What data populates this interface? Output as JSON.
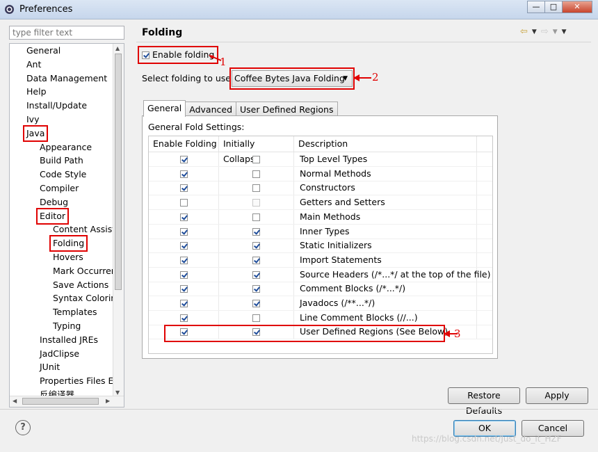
{
  "window": {
    "title": "Preferences",
    "controls": {
      "minimize": "—",
      "maximize": "□",
      "close": "✕"
    }
  },
  "filter": {
    "placeholder": "type filter text"
  },
  "tree": {
    "items": [
      {
        "label": "General",
        "level": 1
      },
      {
        "label": "Ant",
        "level": 1
      },
      {
        "label": "Data Management",
        "level": 1
      },
      {
        "label": "Help",
        "level": 1
      },
      {
        "label": "Install/Update",
        "level": 1
      },
      {
        "label": "Ivy",
        "level": 1
      },
      {
        "label": "Java",
        "level": 1
      },
      {
        "label": "Appearance",
        "level": 2
      },
      {
        "label": "Build Path",
        "level": 2
      },
      {
        "label": "Code Style",
        "level": 2
      },
      {
        "label": "Compiler",
        "level": 2
      },
      {
        "label": "Debug",
        "level": 2
      },
      {
        "label": "Editor",
        "level": 2
      },
      {
        "label": "Content Assist",
        "level": 3
      },
      {
        "label": "Folding",
        "level": 3
      },
      {
        "label": "Hovers",
        "level": 3
      },
      {
        "label": "Mark Occurren",
        "level": 3
      },
      {
        "label": "Save Actions",
        "level": 3
      },
      {
        "label": "Syntax Coloring",
        "level": 3
      },
      {
        "label": "Templates",
        "level": 3
      },
      {
        "label": "Typing",
        "level": 3
      },
      {
        "label": "Installed JREs",
        "level": 2
      },
      {
        "label": "JadClipse",
        "level": 2
      },
      {
        "label": "JUnit",
        "level": 2
      },
      {
        "label": "Properties Files Ed",
        "level": 2
      },
      {
        "label": "反编译器",
        "level": 2
      }
    ]
  },
  "page": {
    "title": "Folding",
    "enable_folding_label": "Enable folding",
    "enable_folding_checked": true,
    "select_label": "Select folding to use:",
    "select_value": "Coffee Bytes Java Folding",
    "tabs": [
      {
        "label": "General",
        "active": true
      },
      {
        "label": "Advanced",
        "active": false
      },
      {
        "label": "User Defined Regions",
        "active": false
      }
    ],
    "group_label": "General Fold Settings:",
    "columns": [
      "Enable Folding",
      "Initially Collapse",
      "Description"
    ],
    "rows": [
      {
        "enable": true,
        "collapse": false,
        "collapse_disabled": false,
        "description": "Top Level Types"
      },
      {
        "enable": true,
        "collapse": false,
        "collapse_disabled": false,
        "description": "Normal Methods"
      },
      {
        "enable": true,
        "collapse": false,
        "collapse_disabled": false,
        "description": "Constructors"
      },
      {
        "enable": false,
        "collapse": false,
        "collapse_disabled": true,
        "description": "Getters and Setters"
      },
      {
        "enable": true,
        "collapse": false,
        "collapse_disabled": false,
        "description": "Main Methods"
      },
      {
        "enable": true,
        "collapse": true,
        "collapse_disabled": false,
        "description": "Inner Types"
      },
      {
        "enable": true,
        "collapse": true,
        "collapse_disabled": false,
        "description": "Static Initializers"
      },
      {
        "enable": true,
        "collapse": true,
        "collapse_disabled": false,
        "description": "Import Statements"
      },
      {
        "enable": true,
        "collapse": true,
        "collapse_disabled": false,
        "description": "Source Headers (/*...*/ at the top of the file)"
      },
      {
        "enable": true,
        "collapse": true,
        "collapse_disabled": false,
        "description": "Comment Blocks (/*...*/)"
      },
      {
        "enable": true,
        "collapse": true,
        "collapse_disabled": false,
        "description": "Javadocs (/**...*/)"
      },
      {
        "enable": true,
        "collapse": false,
        "collapse_disabled": false,
        "description": "Line Comment Blocks (//...)"
      },
      {
        "enable": true,
        "collapse": true,
        "collapse_disabled": false,
        "description": "User Defined Regions (See Below)"
      }
    ],
    "restore_defaults_label": "Restore Defaults",
    "apply_label": "Apply"
  },
  "annotations": {
    "a1": "1",
    "a2": "2",
    "a3": "3"
  },
  "dialog": {
    "ok_label": "OK",
    "cancel_label": "Cancel",
    "help_symbol": "?"
  },
  "watermark": "https://blog.csdn.net/Just_do_it_HZF",
  "colors": {
    "annotation_red": "#e00000",
    "check_blue": "#1f4d9a"
  }
}
